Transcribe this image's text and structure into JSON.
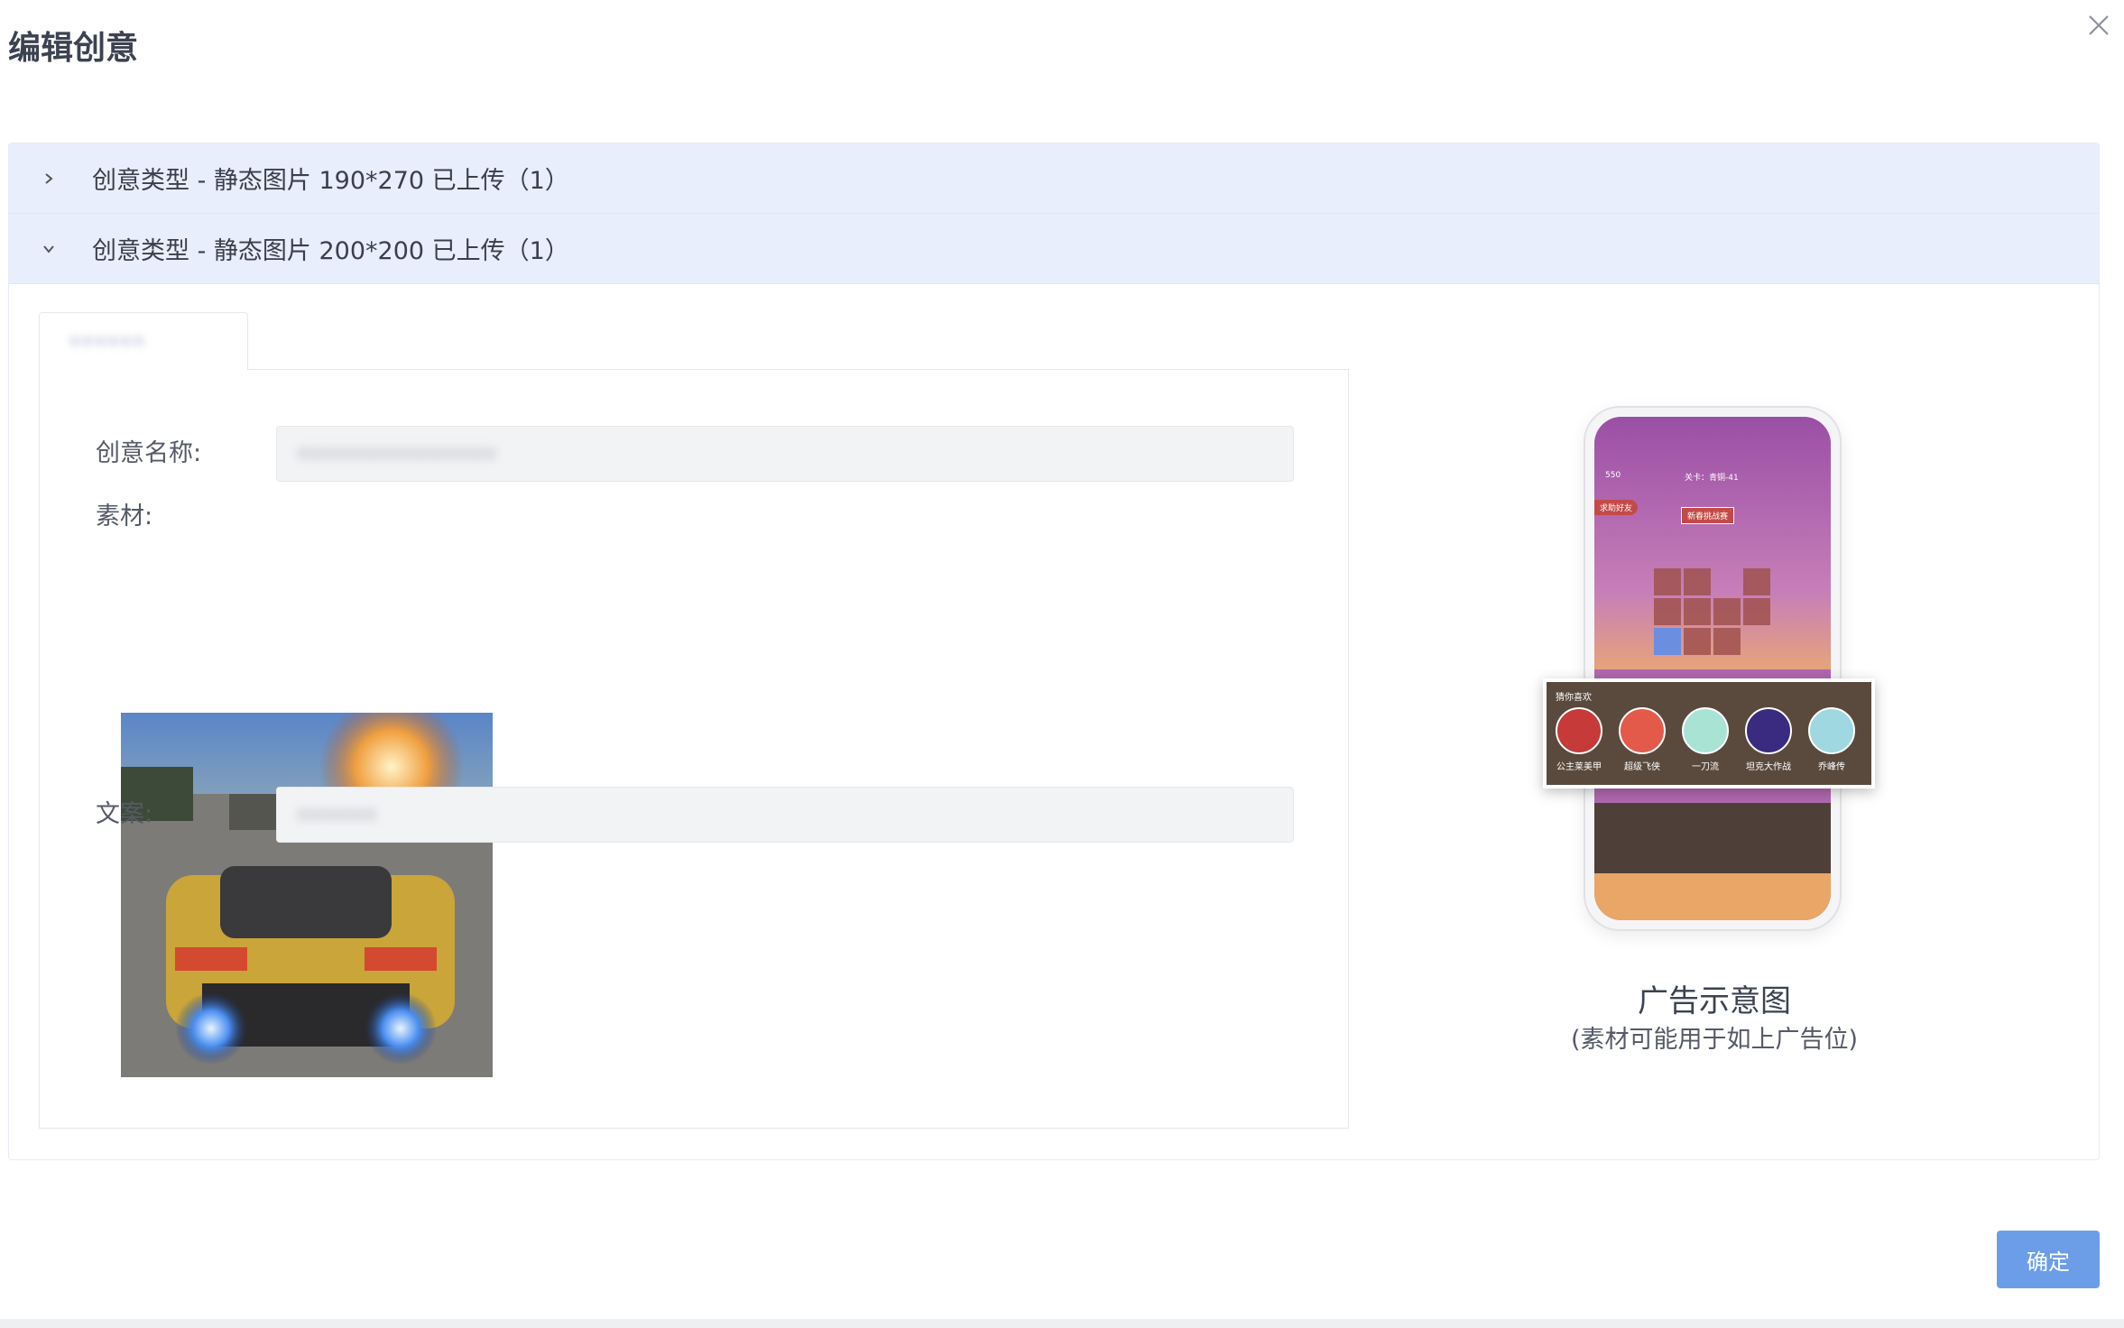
{
  "dialog": {
    "title": "编辑创意",
    "confirm_label": "确定"
  },
  "collapse": [
    {
      "label": "创意类型 - 静态图片 190*270 已上传（1）",
      "expanded": false
    },
    {
      "label": "创意类型 - 静态图片 200*200 已上传（1）",
      "expanded": true
    }
  ],
  "tab": {
    "label": "••••••"
  },
  "form": {
    "name_label": "创意名称:",
    "name_value": "•••••••••••••••",
    "material_label": "素材:",
    "copy_label": "文案:",
    "copy_value": "••••••"
  },
  "preview": {
    "caption": "广告示意图",
    "subcaption": "(素材可能用于如上广告位)",
    "game_hud": {
      "coins": "550",
      "level": "关卡：青铜-41",
      "help": "求助好友",
      "event": "新春挑战赛"
    },
    "popup_title": "猜你喜欢",
    "games": [
      "公主莱美甲",
      "超级飞侠",
      "一刀流",
      "坦克大作战",
      "乔峰传"
    ]
  },
  "colors": {
    "header_bg": "#e8eefb",
    "primary": "#6c9ee8",
    "phone_screen": "#b068b0",
    "popup_bg": "#5a4a3e"
  }
}
